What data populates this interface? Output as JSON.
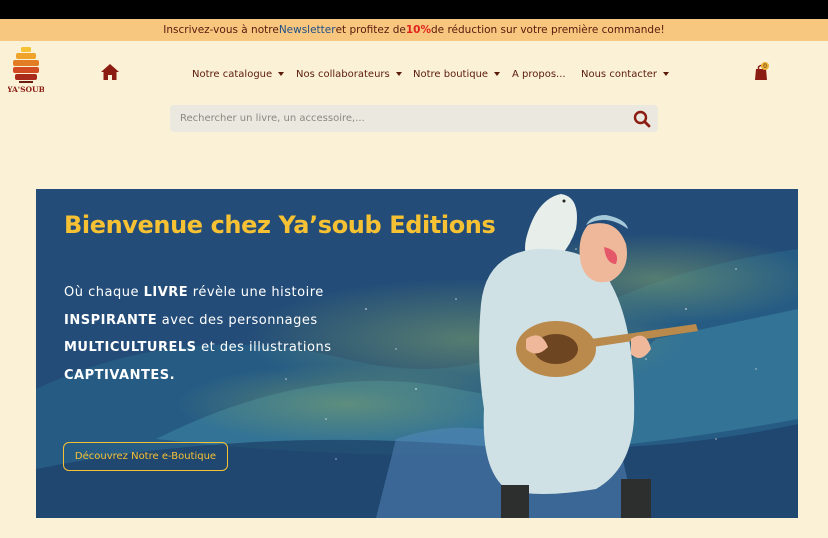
{
  "promo": {
    "before": "Inscrivez-vous à notre ",
    "newsletter": "Newsletter",
    "middle": " et profitez de ",
    "discount": "10%",
    "after": " de réduction sur votre première commande!"
  },
  "logo": {
    "text": "YA'SOUB"
  },
  "nav": {
    "items": [
      {
        "label": "Notre catalogue",
        "dropdown": true
      },
      {
        "label": "Nos collaborateurs",
        "dropdown": true
      },
      {
        "label": "Notre boutique",
        "dropdown": true
      },
      {
        "label": "A propos...",
        "dropdown": false
      },
      {
        "label": "Nous contacter",
        "dropdown": true
      }
    ]
  },
  "cart": {
    "count": "0"
  },
  "search": {
    "placeholder": "Rechercher un livre, un accessoire,..."
  },
  "hero": {
    "title": "Bienvenue chez Ya’soub Editions",
    "line1_a": "Où chaque ",
    "line1_b": "LIVRE",
    "line1_c": " révèle une histoire",
    "line2_a": "INSPIRANTE",
    "line2_b": " avec des personnages",
    "line3_a": "MULTICULTURELS",
    "line3_b": " et des illustrations",
    "line4_a": "CAPTIVANTES.",
    "button": "Découvrez Notre e-Boutique"
  },
  "colors": {
    "brand": "#5a1a0c",
    "accent": "#f6c234",
    "promo_bg": "#f8c77f",
    "hero_bg": "#234d78",
    "page_bg": "#fbf1d6"
  }
}
